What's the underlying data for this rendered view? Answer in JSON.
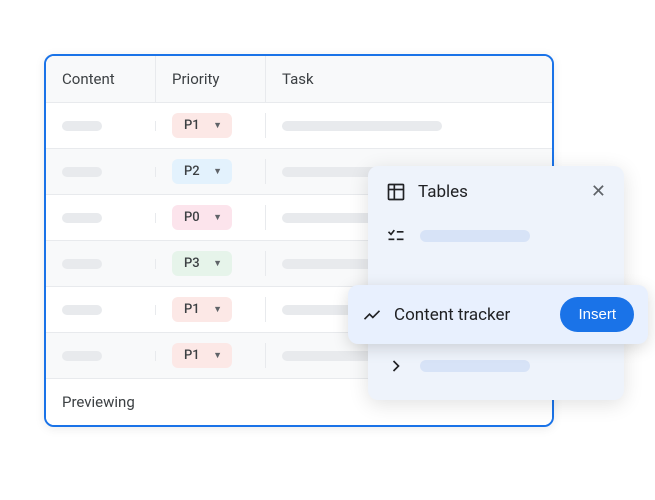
{
  "table": {
    "headers": {
      "content": "Content",
      "priority": "Priority",
      "task": "Task"
    },
    "rows": [
      {
        "priority": "P1",
        "priority_class": "p1"
      },
      {
        "priority": "P2",
        "priority_class": "p2"
      },
      {
        "priority": "P0",
        "priority_class": "p0"
      },
      {
        "priority": "P3",
        "priority_class": "p3"
      },
      {
        "priority": "P1",
        "priority_class": "p1"
      },
      {
        "priority": "P1",
        "priority_class": "p1"
      }
    ],
    "footer": "Previewing"
  },
  "popup": {
    "title": "Tables",
    "selected": {
      "label": "Content tracker",
      "button": "Insert"
    }
  }
}
